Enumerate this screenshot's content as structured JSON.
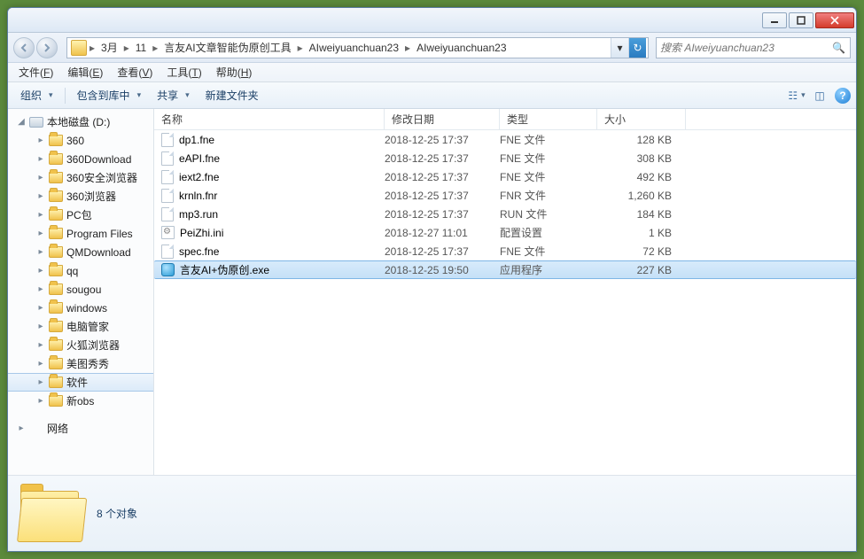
{
  "breadcrumb": [
    "3月",
    "11",
    "言友AI文章智能伪原创工具",
    "AIweiyuanchuan23",
    "AIweiyuanchuan23"
  ],
  "search_placeholder": "搜索 AIweiyuanchuan23",
  "menus": [
    {
      "label": "文件",
      "accel": "F"
    },
    {
      "label": "编辑",
      "accel": "E"
    },
    {
      "label": "查看",
      "accel": "V"
    },
    {
      "label": "工具",
      "accel": "T"
    },
    {
      "label": "帮助",
      "accel": "H"
    }
  ],
  "toolbar": {
    "organize": "组织",
    "include": "包含到库中",
    "share": "共享",
    "newfolder": "新建文件夹"
  },
  "columns": {
    "name": "名称",
    "date": "修改日期",
    "type": "类型",
    "size": "大小"
  },
  "tree": {
    "drive": "本地磁盘 (D:)",
    "items": [
      "360",
      "360Download",
      "360安全浏览器",
      "360浏览器",
      "PC包",
      "Program Files",
      "QMDownload",
      "qq",
      "sougou",
      "windows",
      "电脑管家",
      "火狐浏览器",
      "美图秀秀",
      "软件",
      "新obs"
    ],
    "selected": "软件",
    "network": "网络"
  },
  "files": [
    {
      "icon": "file",
      "name": "dp1.fne",
      "date": "2018-12-25 17:37",
      "type": "FNE 文件",
      "size": "128 KB"
    },
    {
      "icon": "file",
      "name": "eAPI.fne",
      "date": "2018-12-25 17:37",
      "type": "FNE 文件",
      "size": "308 KB"
    },
    {
      "icon": "file",
      "name": "iext2.fne",
      "date": "2018-12-25 17:37",
      "type": "FNE 文件",
      "size": "492 KB"
    },
    {
      "icon": "file",
      "name": "krnln.fnr",
      "date": "2018-12-25 17:37",
      "type": "FNR 文件",
      "size": "1,260 KB"
    },
    {
      "icon": "file",
      "name": "mp3.run",
      "date": "2018-12-25 17:37",
      "type": "RUN 文件",
      "size": "184 KB"
    },
    {
      "icon": "ini",
      "name": "PeiZhi.ini",
      "date": "2018-12-27 11:01",
      "type": "配置设置",
      "size": "1 KB"
    },
    {
      "icon": "file",
      "name": "spec.fne",
      "date": "2018-12-25 17:37",
      "type": "FNE 文件",
      "size": "72 KB"
    },
    {
      "icon": "exe",
      "name": "言友AI+伪原创.exe",
      "date": "2018-12-25 19:50",
      "type": "应用程序",
      "size": "227 KB",
      "selected": true
    }
  ],
  "status": "8 个对象"
}
